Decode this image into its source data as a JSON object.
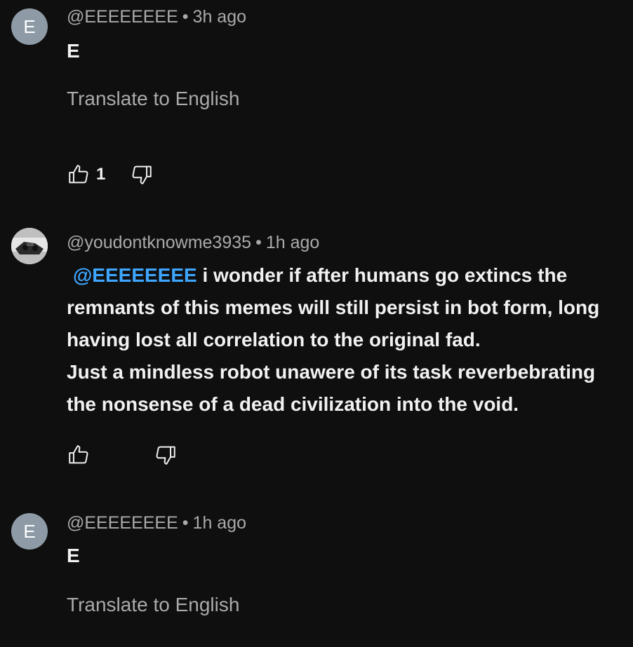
{
  "comments": [
    {
      "avatar_letter": "E",
      "avatar_color": "#8e9ba6",
      "author": "@EEEEEEEE",
      "separator": "•",
      "time": "3h ago",
      "text": "E",
      "translate_label": "Translate to English",
      "like_count": "1"
    },
    {
      "author": "@youdontknowme3935",
      "separator": "•",
      "time": "1h ago",
      "mention": "@EEEEEEEE",
      "text_after_mention": " i wonder if after humans go extincs the remnants of this memes will still persist in bot form, long having lost all correlation to the original fad.",
      "text_line2": "Just a mindless robot unawere of its task reverbebrating the nonsense of a dead civilization into the void."
    },
    {
      "avatar_letter": "E",
      "avatar_color": "#8e9ba6",
      "author": "@EEEEEEEE",
      "separator": "•",
      "time": "1h ago",
      "text": "E",
      "translate_label": "Translate to English"
    }
  ],
  "colors": {
    "background": "#0f0f0f",
    "primary_text": "#f1f1f1",
    "secondary_text": "#aaaaaa",
    "mention": "#3ea6ff"
  }
}
